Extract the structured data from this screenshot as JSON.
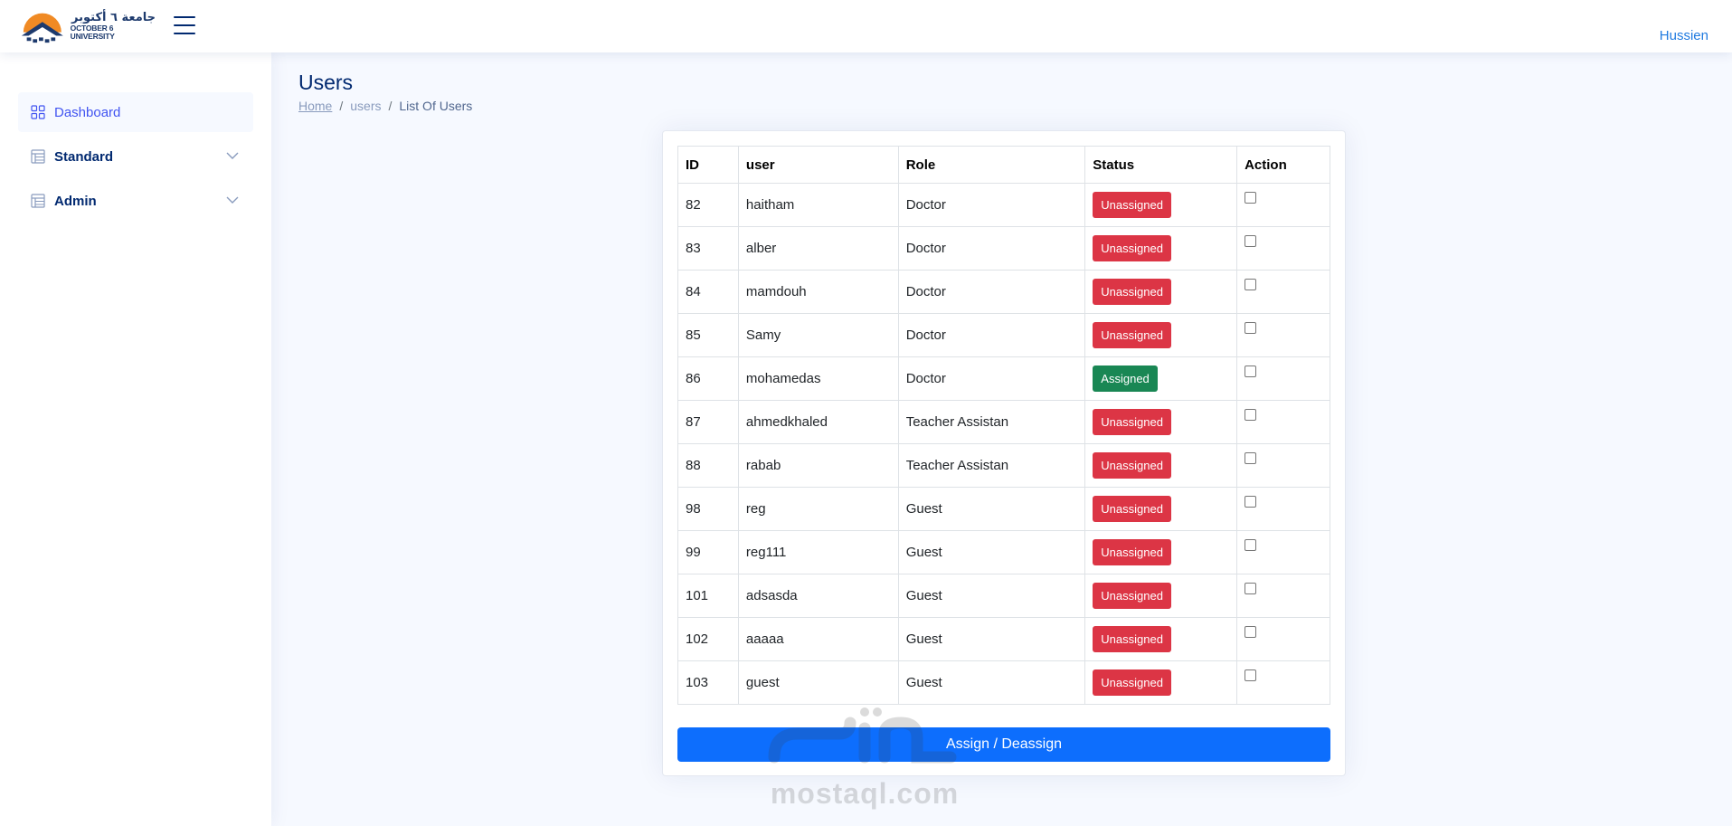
{
  "header": {
    "logo_arabic": "جامعة ٦ أكتوبر",
    "logo_english": "OCTOBER 6 UNIVERSITY",
    "user_name": "Hussien"
  },
  "sidebar": {
    "items": [
      {
        "label": "Dashboard",
        "icon": "grid-icon",
        "active": true
      },
      {
        "label": "Standard",
        "icon": "table-icon",
        "expandable": true
      },
      {
        "label": "Admin",
        "icon": "table-icon",
        "expandable": true
      }
    ]
  },
  "page": {
    "title": "Users",
    "breadcrumb": {
      "home": "Home",
      "section": "users",
      "current": "List Of Users",
      "separator": "/"
    }
  },
  "table": {
    "columns": [
      "ID",
      "user",
      "Role",
      "Status",
      "Action"
    ],
    "rows": [
      {
        "id": "82",
        "user": "haitham",
        "role": "Doctor",
        "status": "Unassigned"
      },
      {
        "id": "83",
        "user": "alber",
        "role": "Doctor",
        "status": "Unassigned"
      },
      {
        "id": "84",
        "user": "mamdouh",
        "role": "Doctor",
        "status": "Unassigned"
      },
      {
        "id": "85",
        "user": "Samy",
        "role": "Doctor",
        "status": "Unassigned"
      },
      {
        "id": "86",
        "user": "mohamedas",
        "role": "Doctor",
        "status": "Assigned"
      },
      {
        "id": "87",
        "user": "ahmedkhaled",
        "role": "Teacher Assistan",
        "status": "Unassigned"
      },
      {
        "id": "88",
        "user": "rabab",
        "role": "Teacher Assistan",
        "status": "Unassigned"
      },
      {
        "id": "98",
        "user": "reg",
        "role": "Guest",
        "status": "Unassigned"
      },
      {
        "id": "99",
        "user": "reg111",
        "role": "Guest",
        "status": "Unassigned"
      },
      {
        "id": "101",
        "user": "adsasda",
        "role": "Guest",
        "status": "Unassigned"
      },
      {
        "id": "102",
        "user": "aaaaa",
        "role": "Guest",
        "status": "Unassigned"
      },
      {
        "id": "103",
        "user": "guest",
        "role": "Guest",
        "status": "Unassigned"
      }
    ]
  },
  "actions": {
    "assign_button": "Assign / Deassign"
  },
  "watermark": {
    "arabic": "مستقل",
    "english": "mostaql.com"
  },
  "colors": {
    "primary": "#0d6efd",
    "unassigned": "#dc3545",
    "assigned": "#198754",
    "nav_text": "#012970",
    "nav_active": "#4154f1",
    "user_link": "#1f7ae0"
  }
}
